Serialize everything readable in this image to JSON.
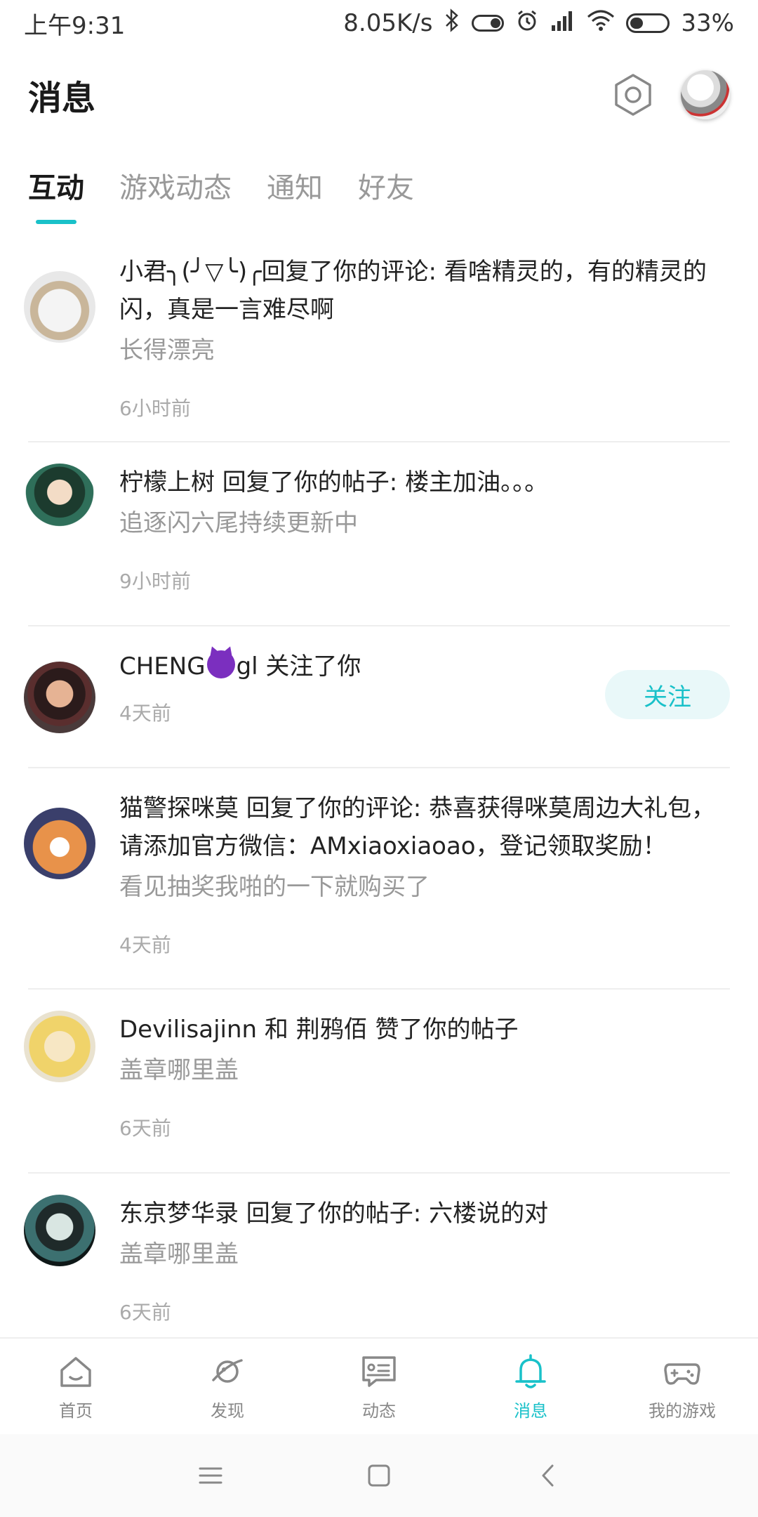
{
  "status_bar": {
    "time": "上午9:31",
    "speed": "8.05K/s",
    "battery": "33%"
  },
  "header": {
    "title": "消息"
  },
  "tabs": [
    {
      "label": "互动",
      "active": true
    },
    {
      "label": "游戏动态",
      "active": false
    },
    {
      "label": "通知",
      "active": false
    },
    {
      "label": "好友",
      "active": false
    }
  ],
  "messages": [
    {
      "text": "小君╮(╯▽╰)╭回复了你的评论: 看啥精灵的，有的精灵的闪，真是一言难尽啊",
      "sub": "长得漂亮",
      "time": "6小时前"
    },
    {
      "text": "柠檬上树 回复了你的帖子: 楼主加油。。。",
      "sub": "追逐闪六尾持续更新中",
      "time": "9小时前"
    },
    {
      "name_before": "CHENG",
      "name_after": "gl",
      "text_after": " 关注了你",
      "time": "4天前",
      "follow_label": "关注"
    },
    {
      "text": "猫警探咪莫 回复了你的评论: 恭喜获得咪莫周边大礼包，请添加官方微信：AMxiaoxiaoao，登记领取奖励！",
      "sub": "看见抽奖我啪的一下就购买了",
      "time": "4天前"
    },
    {
      "text": "Devilisajinn 和 荆鸦佰 赞了你的帖子",
      "sub": "盖章哪里盖",
      "time": "6天前"
    },
    {
      "text": "东京梦华录 回复了你的帖子: 六楼说的对",
      "sub": "盖章哪里盖",
      "time": "6天前"
    }
  ],
  "bottom_nav": [
    {
      "label": "首页",
      "icon": "home-icon",
      "active": false
    },
    {
      "label": "发现",
      "icon": "planet-icon",
      "active": false
    },
    {
      "label": "动态",
      "icon": "feed-icon",
      "active": false
    },
    {
      "label": "消息",
      "icon": "bell-icon",
      "active": true
    },
    {
      "label": "我的游戏",
      "icon": "gamepad-icon",
      "active": false
    }
  ],
  "colors": {
    "accent": "#19c1c9",
    "follow_bg": "#e9f8f9"
  }
}
